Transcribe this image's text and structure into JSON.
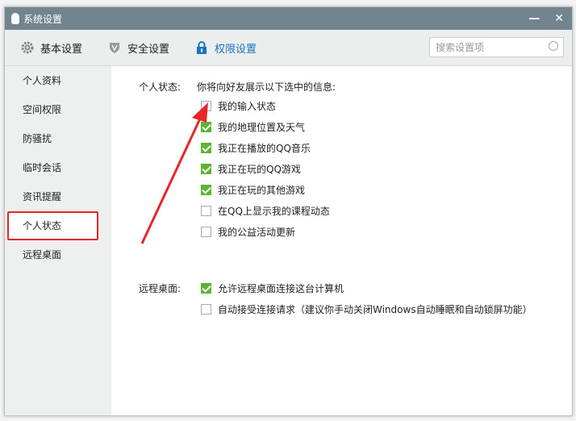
{
  "window": {
    "title": "系统设置",
    "minimize": "—",
    "close": "✕"
  },
  "tabs": [
    {
      "label": "基本设置",
      "icon": "gear-icon"
    },
    {
      "label": "安全设置",
      "icon": "shield-icon"
    },
    {
      "label": "权限设置",
      "icon": "lock-icon"
    }
  ],
  "search": {
    "placeholder": "搜索设置项"
  },
  "sidebar": {
    "items": [
      "个人资料",
      "空间权限",
      "防骚扰",
      "临时会话",
      "资讯提醒",
      "个人状态",
      "远程桌面"
    ],
    "selected": 5
  },
  "status": {
    "label": "个人状态:",
    "intro": "你将向好友展示以下选中的信息:",
    "options": [
      {
        "label": "我的输入状态",
        "checked": false
      },
      {
        "label": "我的地理位置及天气",
        "checked": true
      },
      {
        "label": "我正在播放的QQ音乐",
        "checked": true
      },
      {
        "label": "我正在玩的QQ游戏",
        "checked": true
      },
      {
        "label": "我正在玩的其他游戏",
        "checked": true
      },
      {
        "label": "在QQ上显示我的课程动态",
        "checked": false
      },
      {
        "label": "我的公益活动更新",
        "checked": false
      }
    ]
  },
  "remote": {
    "label": "远程桌面:",
    "options": [
      {
        "label": "允许远程桌面连接这台计算机",
        "checked": true
      },
      {
        "label": "自动接受连接请求（建议你手动关闭Windows自动睡眠和自动锁屏功能）",
        "checked": false
      }
    ]
  },
  "colors": {
    "accent": "#1a74c4",
    "check": "#5cb531",
    "highlight": "#e8262a",
    "titlebar": "#72848e"
  }
}
